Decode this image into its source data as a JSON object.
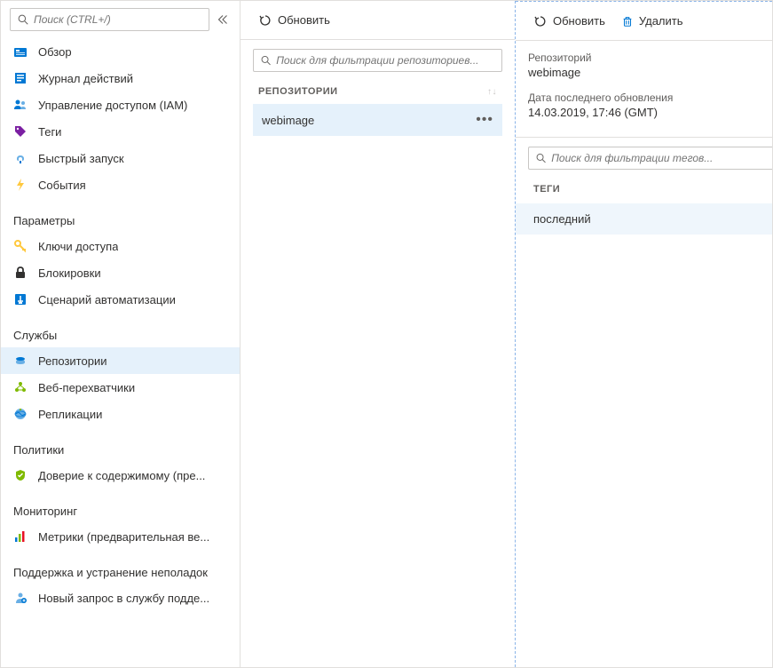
{
  "sidebar": {
    "search_placeholder": "Поиск (CTRL+/)",
    "items_top": [
      {
        "label": "Обзор",
        "icon": "overview"
      },
      {
        "label": "Журнал действий",
        "icon": "activity-log"
      },
      {
        "label": "Управление доступом (IAM)",
        "icon": "iam"
      },
      {
        "label": "Теги",
        "icon": "tags"
      },
      {
        "label": "Быстрый запуск",
        "icon": "quickstart"
      },
      {
        "label": "События",
        "icon": "events"
      }
    ],
    "sections": [
      {
        "title": "Параметры",
        "items": [
          {
            "label": "Ключи доступа",
            "icon": "keys"
          },
          {
            "label": "Блокировки",
            "icon": "locks"
          },
          {
            "label": "Сценарий автоматизации",
            "icon": "automation"
          }
        ]
      },
      {
        "title": "Службы",
        "items": [
          {
            "label": "Репозитории",
            "icon": "repositories",
            "active": true
          },
          {
            "label": "Веб-перехватчики",
            "icon": "webhooks"
          },
          {
            "label": "Репликации",
            "icon": "replications"
          }
        ]
      },
      {
        "title": "Политики",
        "items": [
          {
            "label": "Доверие к содержимому (пре...",
            "icon": "trust"
          }
        ]
      },
      {
        "title": "Мониторинг",
        "items": [
          {
            "label": "Метрики (предварительная ве...",
            "icon": "metrics"
          }
        ]
      },
      {
        "title": "Поддержка и устранение неполадок",
        "items": [
          {
            "label": "Новый запрос в службу подде...",
            "icon": "support"
          }
        ]
      }
    ]
  },
  "middle": {
    "refresh_label": "Обновить",
    "filter_placeholder": "Поиск для фильтрации репозиториев...",
    "column_header": "РЕПОЗИТОРИИ",
    "repos": [
      {
        "name": "webimage"
      }
    ]
  },
  "right": {
    "refresh_label": "Обновить",
    "delete_label": "Удалить",
    "repo_label": "Репозиторий",
    "repo_value": "webimage",
    "updated_label": "Дата последнего обновления",
    "updated_value": "14.03.2019, 17:46 (GMT)",
    "tag_filter_placeholder": "Поиск для фильтрации тегов...",
    "tags_header": "ТЕГИ",
    "tags": [
      {
        "name": "последний"
      }
    ]
  }
}
